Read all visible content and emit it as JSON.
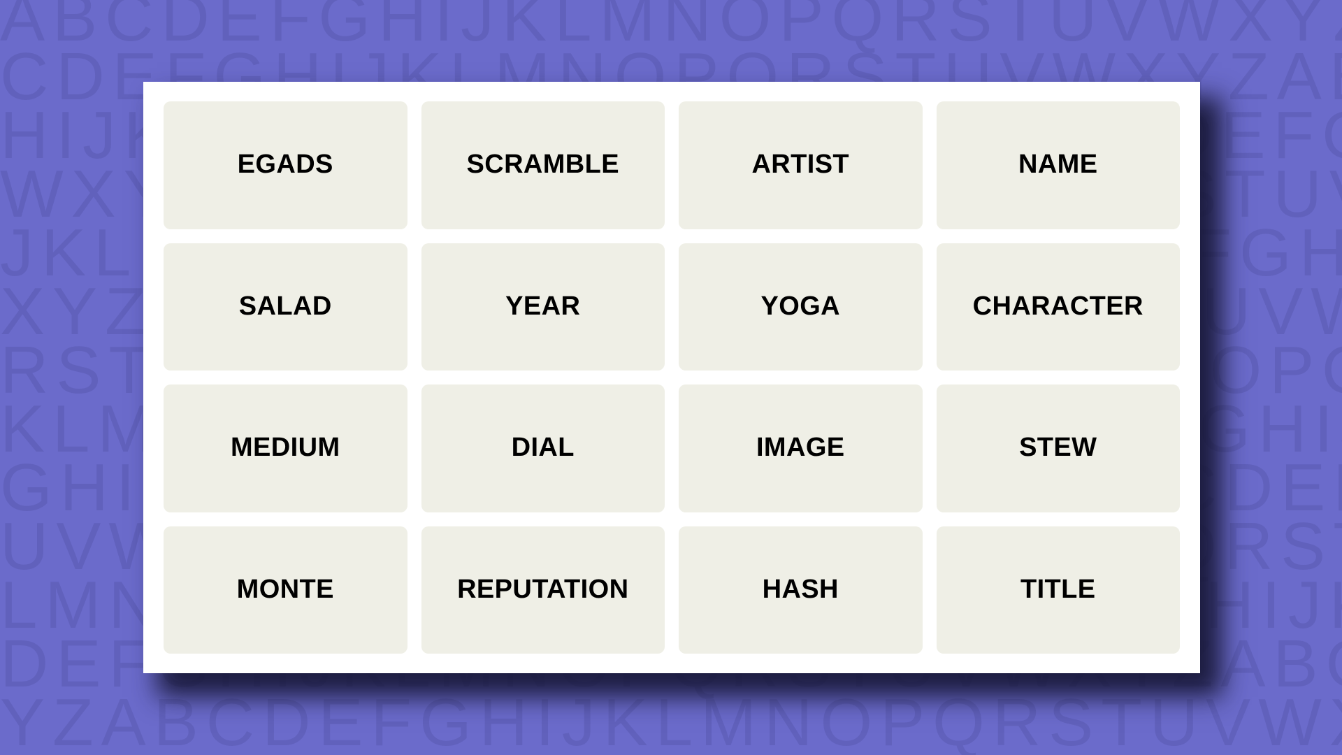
{
  "theme": {
    "background_color": "#6B6BCB",
    "pattern_letter_color": "#6161BC",
    "card_color": "#FFFFFF",
    "tile_color": "#EFEFE6",
    "tile_text_color": "#000000",
    "shadow_color": "#161634"
  },
  "background": {
    "pattern_name": "alphabet-tiling",
    "rows": [
      "ABCDEFGHIJKLMNOPQRSTUVWXYZABCDEFGH",
      "CDEFGHIJKLMNOPQRSTUVWXYZABCDEFGHIJ",
      "HIJKLMNOPQRSTUVWXYZABCDEFGHIJKLMNO",
      "WXYZABCDEFGHIJKLMNOPQRSTUVWXYZABCD",
      "JKLMNOPQRSTUVWXYZABCDEFGHIJKLMNOPQ",
      "XYZABCDEFGHIJKLMNOPQRSTUVWXYZABCDE",
      "RSTUVWXYZABCDEFGHIJKLMNOPQRSTUVWXY",
      "KLMNOPQRSTUVWXYZABCDEFGHIJKLMNOPQR",
      "GHIJKLMNOPQRSTUVWXYZABCDEFGHIJKLMN",
      "UVWXYZABCDEFGHIJKLMNOPQRSTUVWXYZAB",
      "LMNOPQRSTUVWXYZABCDEFGHIJKLMNOPQRS",
      "DEFGHIJKLMNOPQRSTUVWXYZABCDEFGHIJK",
      "YZABCDEFGHIJKLMNOPQRSTUVWXYZABCDEF"
    ]
  },
  "puzzle": {
    "columns": 4,
    "rows": 4,
    "tiles": [
      {
        "word": "EGADS",
        "row": 1,
        "col": 1,
        "selected": false,
        "solved": false
      },
      {
        "word": "SCRAMBLE",
        "row": 1,
        "col": 2,
        "selected": false,
        "solved": false
      },
      {
        "word": "ARTIST",
        "row": 1,
        "col": 3,
        "selected": false,
        "solved": false
      },
      {
        "word": "NAME",
        "row": 1,
        "col": 4,
        "selected": false,
        "solved": false
      },
      {
        "word": "SALAD",
        "row": 2,
        "col": 1,
        "selected": false,
        "solved": false
      },
      {
        "word": "YEAR",
        "row": 2,
        "col": 2,
        "selected": false,
        "solved": false
      },
      {
        "word": "YOGA",
        "row": 2,
        "col": 3,
        "selected": false,
        "solved": false
      },
      {
        "word": "CHARACTER",
        "row": 2,
        "col": 4,
        "selected": false,
        "solved": false
      },
      {
        "word": "MEDIUM",
        "row": 3,
        "col": 1,
        "selected": false,
        "solved": false
      },
      {
        "word": "DIAL",
        "row": 3,
        "col": 2,
        "selected": false,
        "solved": false
      },
      {
        "word": "IMAGE",
        "row": 3,
        "col": 3,
        "selected": false,
        "solved": false
      },
      {
        "word": "STEW",
        "row": 3,
        "col": 4,
        "selected": false,
        "solved": false
      },
      {
        "word": "MONTE",
        "row": 4,
        "col": 1,
        "selected": false,
        "solved": false
      },
      {
        "word": "REPUTATION",
        "row": 4,
        "col": 2,
        "selected": false,
        "solved": false
      },
      {
        "word": "HASH",
        "row": 4,
        "col": 3,
        "selected": false,
        "solved": false
      },
      {
        "word": "TITLE",
        "row": 4,
        "col": 4,
        "selected": false,
        "solved": false
      }
    ]
  }
}
